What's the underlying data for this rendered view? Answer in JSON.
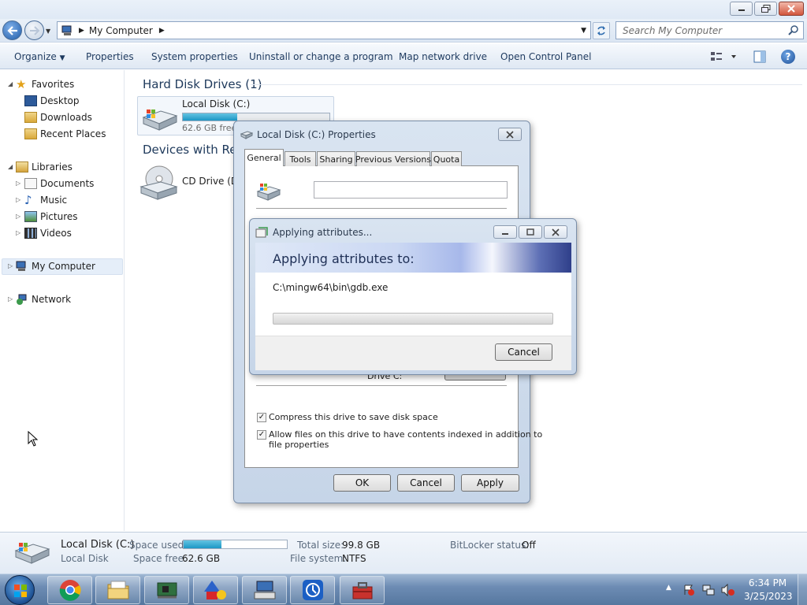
{
  "window": {
    "breadcrumb": "My Computer",
    "search_placeholder": "Search My Computer"
  },
  "toolbar": {
    "organize": "Organize",
    "properties": "Properties",
    "system_properties": "System properties",
    "uninstall": "Uninstall or change a program",
    "map_drive": "Map network drive",
    "control_panel": "Open Control Panel"
  },
  "nav": {
    "favorites": "Favorites",
    "desktop": "Desktop",
    "downloads": "Downloads",
    "recent": "Recent Places",
    "libraries": "Libraries",
    "documents": "Documents",
    "music": "Music",
    "pictures": "Pictures",
    "videos": "Videos",
    "computer": "My Computer",
    "network": "Network"
  },
  "content": {
    "hdd_header": "Hard Disk Drives (1)",
    "devices_header": "Devices with Rem",
    "disk_name": "Local Disk (C:)",
    "disk_free": "62.6 GB free",
    "disk_used_fraction": 0.37,
    "cd_name": "CD Drive (D:"
  },
  "details": {
    "name": "Local Disk (C:)",
    "type": "Local Disk",
    "space_used_label": "Space used:",
    "space_free_label": "Space free:",
    "space_free": "62.6 GB",
    "total_size_label": "Total size:",
    "total_size": "99.8 GB",
    "filesystem_label": "File system:",
    "filesystem": "NTFS",
    "bitlocker_label": "BitLocker status:",
    "bitlocker": "Off",
    "used_fraction": 0.37
  },
  "properties_dialog": {
    "title": "Local Disk (C:) Properties",
    "tabs": [
      "General",
      "Tools",
      "Sharing",
      "Previous Versions",
      "Quota"
    ],
    "drive_label": "Drive C:",
    "compress": "Compress this drive to save disk space",
    "index_line1": "Allow files on this drive to have contents indexed in addition to",
    "index_line2": "file properties",
    "ok": "OK",
    "cancel": "Cancel",
    "apply": "Apply"
  },
  "applying_dialog": {
    "title": "Applying attributes...",
    "heading": "Applying attributes to:",
    "path": "C:\\mingw64\\bin\\gdb.exe",
    "progress": 0.0,
    "cancel": "Cancel"
  },
  "clock": {
    "time": "6:34 PM",
    "date": "3/25/2023"
  }
}
